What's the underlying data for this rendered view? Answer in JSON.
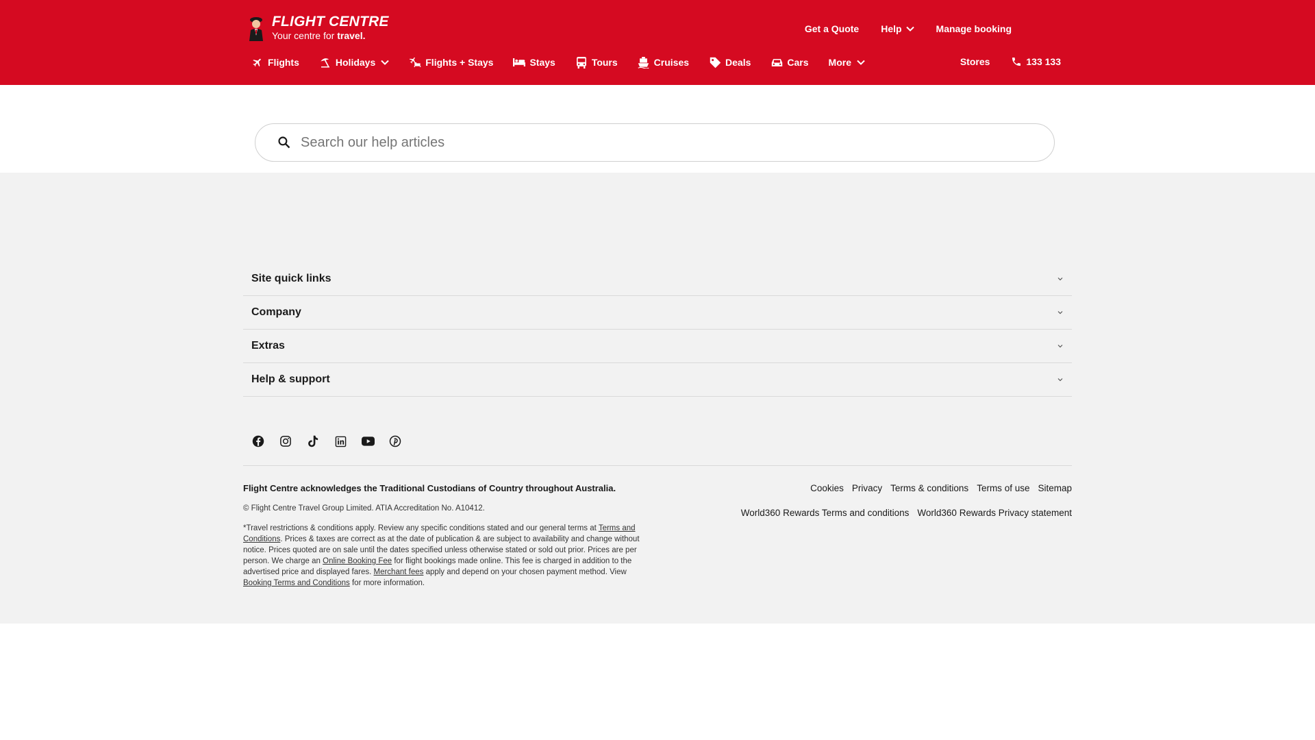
{
  "brand": {
    "title": "FLIGHT CENTRE",
    "tagline_prefix": "Your centre for ",
    "tagline_bold": "travel.",
    "primary_color": "#d50a21"
  },
  "utility_nav": {
    "quote": "Get a Quote",
    "help": "Help",
    "manage": "Manage booking"
  },
  "main_nav": {
    "items": [
      {
        "label": "Flights",
        "icon": "plane-icon"
      },
      {
        "label": "Holidays",
        "icon": "beach-umbrella-icon",
        "dropdown": true
      },
      {
        "label": "Flights + Stays",
        "icon": "plane-hotel-icon"
      },
      {
        "label": "Stays",
        "icon": "bed-icon"
      },
      {
        "label": "Tours",
        "icon": "bus-icon"
      },
      {
        "label": "Cruises",
        "icon": "ship-icon"
      },
      {
        "label": "Deals",
        "icon": "tag-icon"
      },
      {
        "label": "Cars",
        "icon": "car-icon"
      },
      {
        "label": "More",
        "icon": "",
        "dropdown": true
      }
    ]
  },
  "right_nav": {
    "stores": "Stores",
    "phone": "133 133"
  },
  "search": {
    "placeholder": "Search our help articles",
    "value": ""
  },
  "accordion": {
    "items": [
      {
        "label": "Site quick links"
      },
      {
        "label": "Company"
      },
      {
        "label": "Extras"
      },
      {
        "label": "Help & support"
      }
    ]
  },
  "socials": [
    "facebook-icon",
    "instagram-icon",
    "tiktok-icon",
    "linkedin-icon",
    "youtube-icon",
    "pinterest-icon"
  ],
  "footer": {
    "acknowledgement": "Flight Centre acknowledges the Traditional Custodians of Country throughout Australia.",
    "copyright": "© Flight Centre Travel Group Limited. ATIA Accreditation No. A10412.",
    "legal": {
      "p1": "*Travel restrictions & conditions apply. Review any specific conditions stated and our general terms at ",
      "link1": "Terms and Conditions",
      "p2": ". Prices & taxes are correct as at the date of publication & are subject to availability and change without notice. Prices quoted are on sale until the dates specified unless otherwise stated or sold out prior. Prices are per person. We charge an ",
      "link2": "Online Booking Fee",
      "p3": " for flight bookings made online. This fee is charged in addition to the advertised price and displayed fares. ",
      "link3": "Merchant fees",
      "p4": " apply and depend on your chosen payment method. View ",
      "link4": "Booking Terms and Conditions",
      "p5": " for more information."
    },
    "links_row1": [
      "Cookies",
      "Privacy",
      "Terms & conditions",
      "Terms of use",
      "Sitemap"
    ],
    "links_row2": [
      "World360 Rewards Terms and conditions",
      "World360 Rewards Privacy statement"
    ]
  }
}
